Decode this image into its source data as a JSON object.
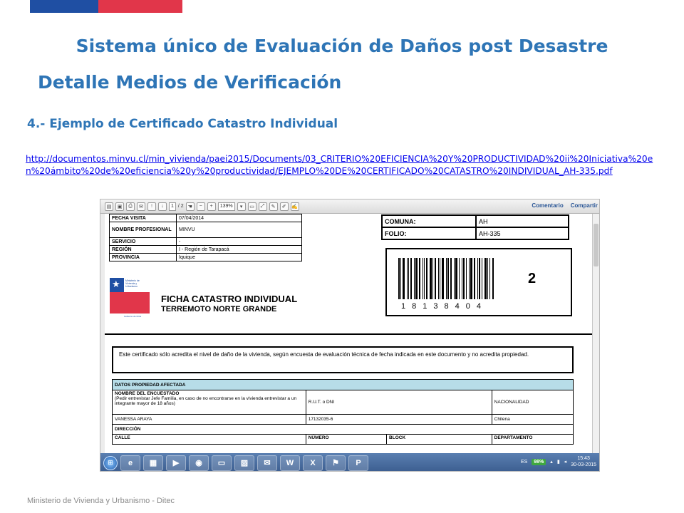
{
  "slide": {
    "title": "Sistema único de  Evaluación de Daños post Desastre",
    "subtitle": "Detalle  Medios de Verificación",
    "section_heading": "4.- Ejemplo de Certificado Catastro Individual",
    "link_url": "http://documentos.minvu.cl/min_vivienda/paei2015/Documents/03_CRITERIO%20EFICIENCIA%20Y%20PRODUCTIVIDAD%20ii%20Iniciativa%20en%20ámbito%20de%20eficiencia%20y%20productividad/EJEMPLO%20DE%20CERTIFICADO%20CATASTRO%20INDIVIDUAL_AH-335.pdf",
    "footer": "Ministerio de Vivienda y Urbanismo - Ditec",
    "colors": {
      "accent": "#2e75b6",
      "flag_blue": "#1f4fa3",
      "flag_red": "#e1364a"
    }
  },
  "pdf_toolbar": {
    "page_current": "1",
    "page_total": "/ 2",
    "zoom": "139%",
    "comment_label": "Comentario",
    "share_label": "Compartir"
  },
  "form": {
    "rows": [
      {
        "label": "FECHA VISITA",
        "value": "07/04/2014"
      },
      {
        "label": "NOMBRE PROFESIONAL",
        "value": "MINVU"
      },
      {
        "label": "SERVICIO",
        "value": "-"
      },
      {
        "label": "REGIÓN",
        "value": "I - Región de Tarapacá"
      },
      {
        "label": "PROVINCIA",
        "value": "Iquique"
      }
    ],
    "comuna_label": "COMUNA:",
    "comuna_value": "AH",
    "folio_label": "FOLIO:",
    "folio_value": "AH-335",
    "barcode_digits": "18138404",
    "barcode_number": "2",
    "logo_text": "Ministerio de Vivienda y Urbanismo",
    "logo_footer": "Gobierno de Chile",
    "ficha_title": "FICHA CATASTRO INDIVIDUAL",
    "ficha_subtitle": "TERREMOTO NORTE GRANDE",
    "certificate_text": "Este certificado sólo acredita el nivel de daño de la vivienda, según encuesta de evaluación técnica de fecha indicada en este documento y no acredita propiedad.",
    "section_datos": "DATOS PROPIEDAD AFECTADA",
    "encuestado_label": "NOMBRE DEL ENCUESTADO",
    "encuestado_note": "(Pedir entrevistar Jefe Familia, en caso de no encontrarse en la vivienda entrevistar a un integrante mayor de 18 años)",
    "rut_label": "R.U.T. o DNI",
    "nacionalidad_label": "NACIONALIDAD",
    "encuestado_value": "VANESSA ARAYA",
    "rut_value": "17132035-6",
    "nacionalidad_value": "Chilena",
    "direccion_label": "DIRECCIÓN",
    "calle_label": "CALLE",
    "numero_label": "NÚMERO",
    "block_label": "BLOCK",
    "departamento_label": "DEPARTAMENTO"
  },
  "taskbar": {
    "language": "ES",
    "battery": "98%",
    "time": "15:43",
    "date": "30-03-2015"
  }
}
